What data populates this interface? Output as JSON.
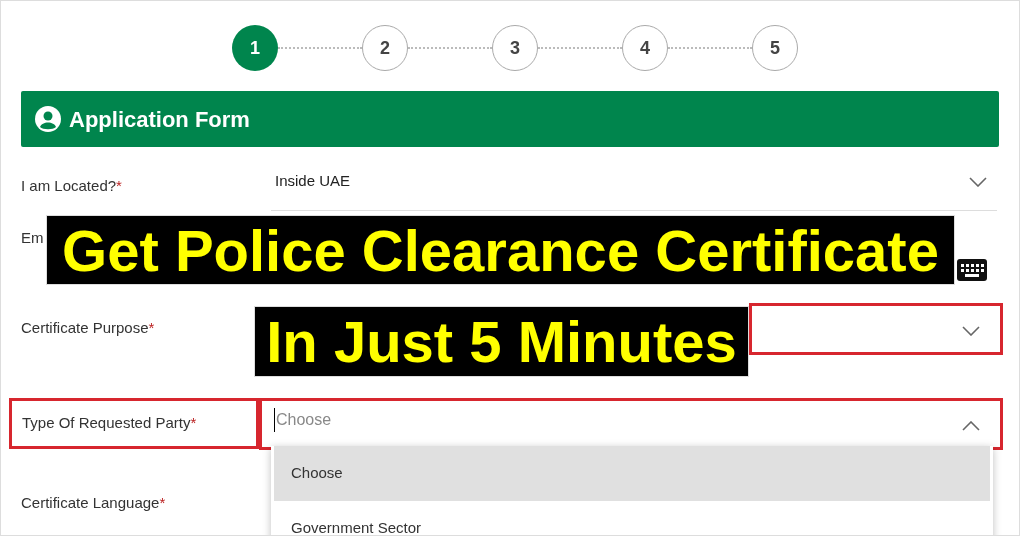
{
  "steps": [
    {
      "label": "1",
      "selected": true
    },
    {
      "label": "2",
      "selected": false
    },
    {
      "label": "3",
      "selected": false
    },
    {
      "label": "4",
      "selected": false
    },
    {
      "label": "5",
      "selected": false
    }
  ],
  "header": {
    "title": "Application Form"
  },
  "fields": [
    {
      "kind": "select",
      "label": "I am Located?",
      "required_mark": "*",
      "value": "Inside UAE",
      "expanded": false
    },
    {
      "kind": "keyboard",
      "label": "Em"
    },
    {
      "kind": "select",
      "label": "Certificate Purpose",
      "required_mark": "*",
      "highlighted": true,
      "expanded": false
    },
    {
      "kind": "select",
      "label": "Type Of Requested Party",
      "required_mark": "*",
      "placeholder": "Choose",
      "highlighted": true,
      "label_highlighted": true,
      "expanded": true,
      "options": [
        {
          "label": "Choose",
          "selected": true
        },
        {
          "label": "Government Sector",
          "selected": false
        }
      ]
    },
    {
      "kind": "label",
      "label": "Certificate Language",
      "required_mark": "*"
    }
  ],
  "overlay": {
    "lines": [
      "Get Police Clearance Certificate",
      "In Just 5 Minutes"
    ]
  }
}
